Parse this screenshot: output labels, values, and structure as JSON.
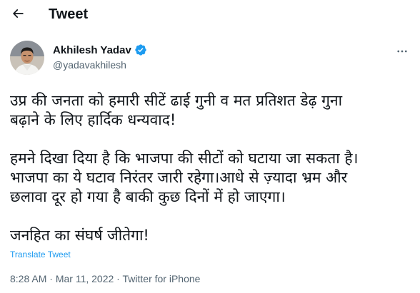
{
  "header": {
    "back_icon": "arrow-left-icon",
    "title": "Tweet"
  },
  "author": {
    "display_name": "Akhilesh Yadav",
    "handle": "@yadavakhilesh",
    "verified_icon": "verified-badge-icon",
    "more_icon": "more-horizontal-icon",
    "accent_color": "#1d9bf0"
  },
  "tweet": {
    "paragraphs": [
      "उप्र की जनता को हमारी सीटें ढाई गुनी व मत प्रतिशत डेढ़ गुना\nबढ़ाने के लिए हार्दिक धन्यवाद!",
      "हमने दिखा दिया है कि भाजपा की सीटों को घटाया जा सकता है।\nभाजपा का ये घटाव निरंतर जारी रहेगा।आधे से ज़्यादा भ्रम और\nछलावा दूर हो गया है बाकी कुछ दिनों में हो जाएगा।",
      "जनहित का संघर्ष जीतेगा!"
    ],
    "translate_label": "Translate Tweet",
    "time": "8:28 AM",
    "separator": " · ",
    "date": "Mar 11, 2022",
    "source": "Twitter for iPhone"
  }
}
